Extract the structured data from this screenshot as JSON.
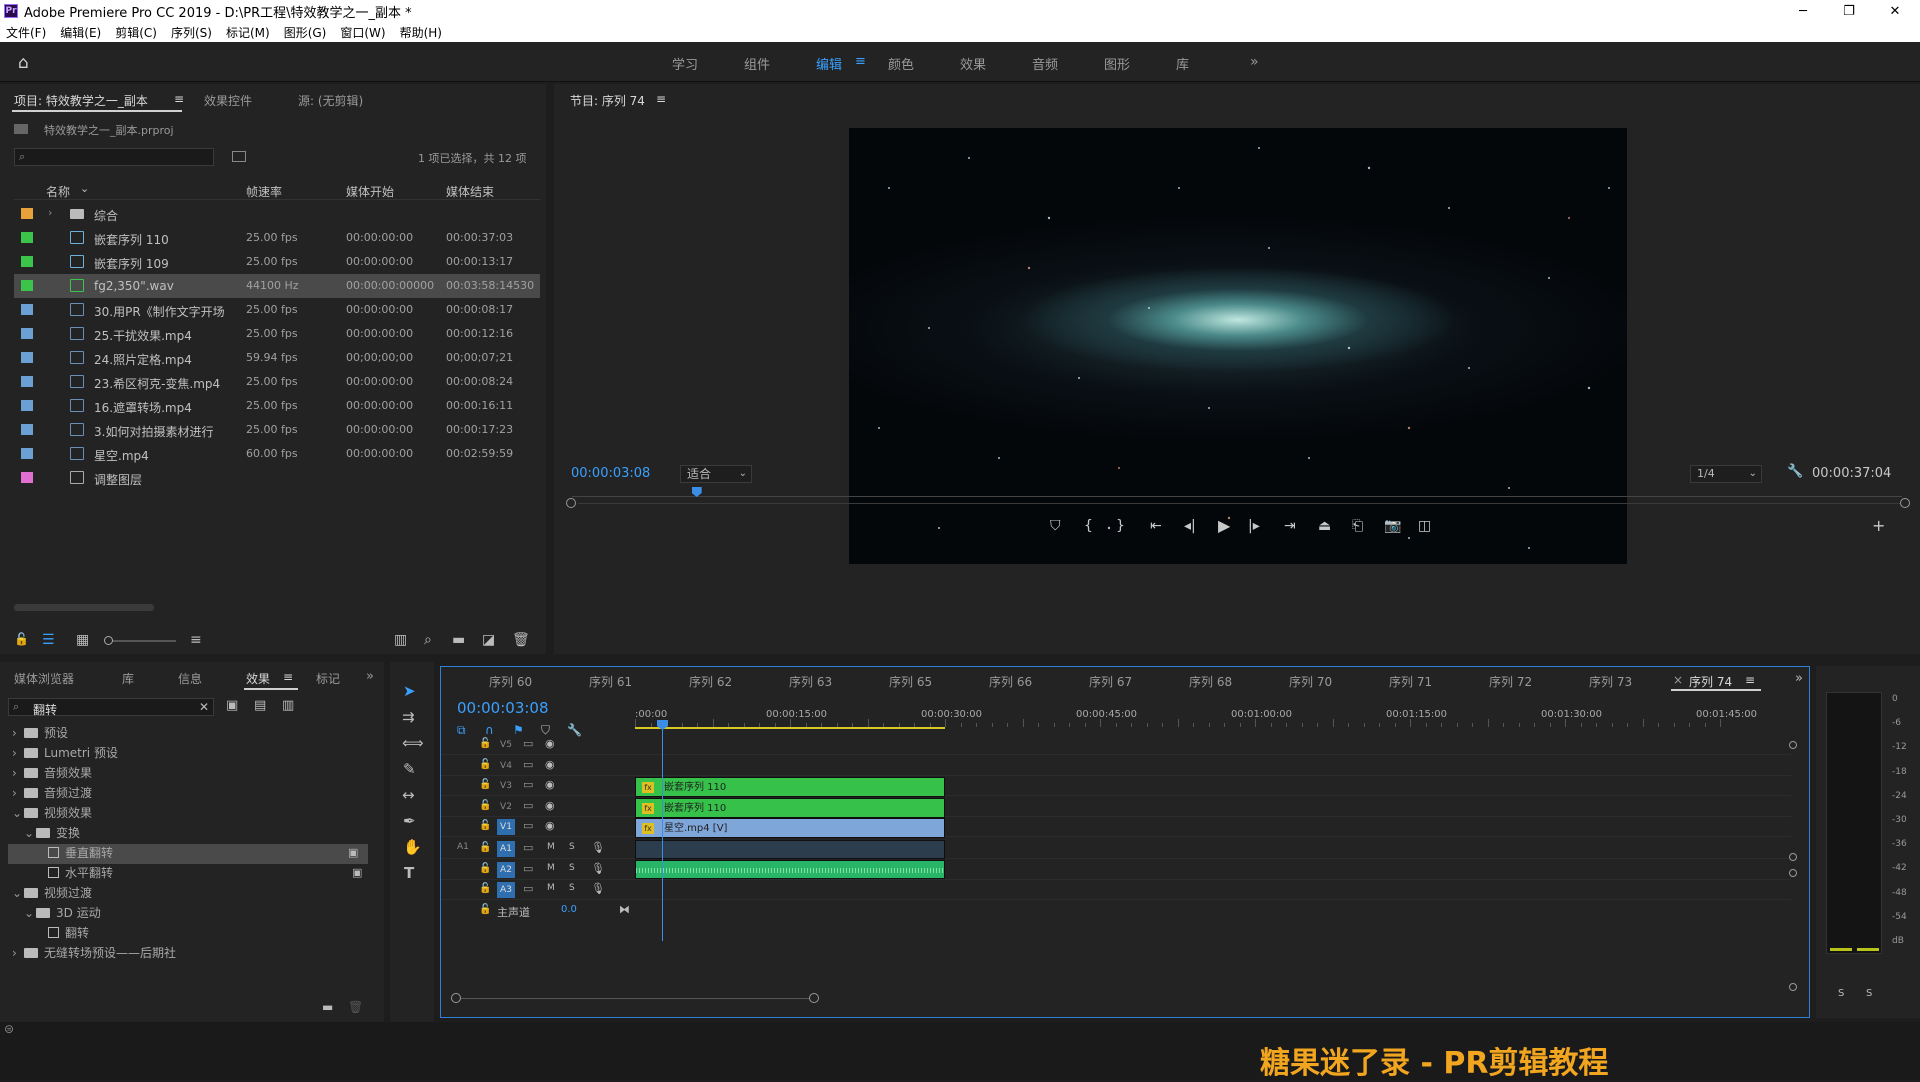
{
  "app": {
    "window_title": "Adobe Premiere Pro CC 2019 - D:\\PR工程\\特效教学之一_副本 *",
    "logo_text": "Pr",
    "menu": [
      "文件(F)",
      "编辑(E)",
      "剪辑(C)",
      "序列(S)",
      "标记(M)",
      "图形(G)",
      "窗口(W)",
      "帮助(H)"
    ]
  },
  "workspaces": {
    "tabs": [
      "学习",
      "组件",
      "编辑",
      "颜色",
      "效果",
      "音频",
      "图形",
      "库"
    ],
    "active": "编辑",
    "more": "»"
  },
  "project": {
    "tab_project": "项目: 特效教学之一_副本",
    "tab_effect_controls": "效果控件",
    "tab_source": "源: (无剪辑)",
    "file_name": "特效教学之一_副本.prproj",
    "selection_info": "1 项已选择，共 12 项",
    "columns": [
      "名称",
      "帧速率",
      "媒体开始",
      "媒体结束"
    ],
    "items": [
      {
        "name": "综合",
        "fps": "",
        "start": "",
        "end": "",
        "color": "#e8a23c",
        "type": "folder"
      },
      {
        "name": "嵌套序列 110",
        "fps": "25.00 fps",
        "start": "00:00:00:00",
        "end": "00:00:37:03",
        "color": "#3cc34a",
        "type": "sequence"
      },
      {
        "name": "嵌套序列 109",
        "fps": "25.00 fps",
        "start": "00:00:00:00",
        "end": "00:00:13:17",
        "color": "#3cc34a",
        "type": "sequence"
      },
      {
        "name": "fg2,350\".wav",
        "fps": "44100 Hz",
        "start": "00:00:00:00000",
        "end": "00:03:58:14530",
        "color": "#3cc34a",
        "type": "audio"
      },
      {
        "name": "30.用PR《制作文字开场",
        "fps": "25.00 fps",
        "start": "00:00:00:00",
        "end": "00:00:08:17",
        "color": "#6c9fd4",
        "type": "video"
      },
      {
        "name": "25.干扰效果.mp4",
        "fps": "25.00 fps",
        "start": "00:00:00:00",
        "end": "00:00:12:16",
        "color": "#6c9fd4",
        "type": "video"
      },
      {
        "name": "24.照片定格.mp4",
        "fps": "59.94 fps",
        "start": "00;00;00;00",
        "end": "00;00;07;21",
        "color": "#6c9fd4",
        "type": "video"
      },
      {
        "name": "23.希区柯克-变焦.mp4",
        "fps": "25.00 fps",
        "start": "00:00:00:00",
        "end": "00:00:08:24",
        "color": "#6c9fd4",
        "type": "video"
      },
      {
        "name": "16.遮罩转场.mp4",
        "fps": "25.00 fps",
        "start": "00:00:00:00",
        "end": "00:00:16:11",
        "color": "#6c9fd4",
        "type": "video"
      },
      {
        "name": "3.如何对拍摄素材进行",
        "fps": "25.00 fps",
        "start": "00:00:00:00",
        "end": "00:00:17:23",
        "color": "#6c9fd4",
        "type": "video"
      },
      {
        "name": "星空.mp4",
        "fps": "60.00 fps",
        "start": "00:00:00:00",
        "end": "00:02:59:59",
        "color": "#6c9fd4",
        "type": "video"
      },
      {
        "name": "调整图层",
        "fps": "",
        "start": "",
        "end": "",
        "color": "#e070d0",
        "type": "adjust"
      }
    ]
  },
  "program": {
    "tab": "节目: 序列 74",
    "timecode": "00:00:03:08",
    "fit": "适合",
    "resolution": "1/4",
    "duration": "00:00:37:04",
    "playhead_fraction": 0.09
  },
  "effects": {
    "tabs": [
      "媒体浏览器",
      "库",
      "信息",
      "效果",
      "标记"
    ],
    "active": "效果",
    "search_value": "翻转",
    "tree": [
      {
        "label": "预设",
        "depth": 0,
        "arrow": "›",
        "icon": "folder"
      },
      {
        "label": "Lumetri 预设",
        "depth": 0,
        "arrow": "›",
        "icon": "folder"
      },
      {
        "label": "音频效果",
        "depth": 0,
        "arrow": "›",
        "icon": "folder"
      },
      {
        "label": "音频过渡",
        "depth": 0,
        "arrow": "›",
        "icon": "folder"
      },
      {
        "label": "视频效果",
        "depth": 0,
        "arrow": "⌄",
        "icon": "folder"
      },
      {
        "label": "变换",
        "depth": 1,
        "arrow": "⌄",
        "icon": "folder"
      },
      {
        "label": "垂直翻转",
        "depth": 2,
        "arrow": "",
        "icon": "effect",
        "selected": true
      },
      {
        "label": "水平翻转",
        "depth": 2,
        "arrow": "",
        "icon": "effect"
      },
      {
        "label": "视频过渡",
        "depth": 0,
        "arrow": "⌄",
        "icon": "folder"
      },
      {
        "label": "3D 运动",
        "depth": 1,
        "arrow": "⌄",
        "icon": "folder"
      },
      {
        "label": "翻转",
        "depth": 2,
        "arrow": "",
        "icon": "effect"
      },
      {
        "label": "无缝转场预设——后期社",
        "depth": 0,
        "arrow": "›",
        "icon": "folder"
      }
    ]
  },
  "timeline": {
    "tabs": [
      "序列 60",
      "序列 61",
      "序列 62",
      "序列 63",
      "序列 65",
      "序列 66",
      "序列 67",
      "序列 68",
      "序列 70",
      "序列 71",
      "序列 72",
      "序列 73",
      "序列 74"
    ],
    "active": "序列 74",
    "close_glyph": "×",
    "timecode": "00:00:03:08",
    "ruler": [
      ":00:00",
      "00:00:15:00",
      "00:00:30:00",
      "00:00:45:00",
      "00:01:00:00",
      "00:01:15:00",
      "00:01:30:00",
      "00:01:45:00"
    ],
    "video_tracks": [
      "V5",
      "V4",
      "V3",
      "V2",
      "V1"
    ],
    "audio_tracks": [
      "A1",
      "A2",
      "A3"
    ],
    "source_patch": "A1",
    "mute": "M",
    "solo": "S",
    "master": {
      "label": "主声道",
      "value": "0.0"
    },
    "clips": {
      "v3": "嵌套序列 110",
      "v2": "嵌套序列 110",
      "v1": "星空.mp4 [V]"
    },
    "clip_colors": {
      "nested": "#36c24a",
      "video": "#7fa6d9",
      "audio": "#28b567"
    }
  },
  "meter": {
    "scale": [
      "0",
      "-6",
      "-12",
      "-18",
      "-24",
      "-30",
      "-36",
      "-42",
      "-48",
      "-54",
      "dB"
    ],
    "solo": [
      "S",
      "S"
    ]
  },
  "watermark": "糖果迷了录 - PR剪辑教程"
}
